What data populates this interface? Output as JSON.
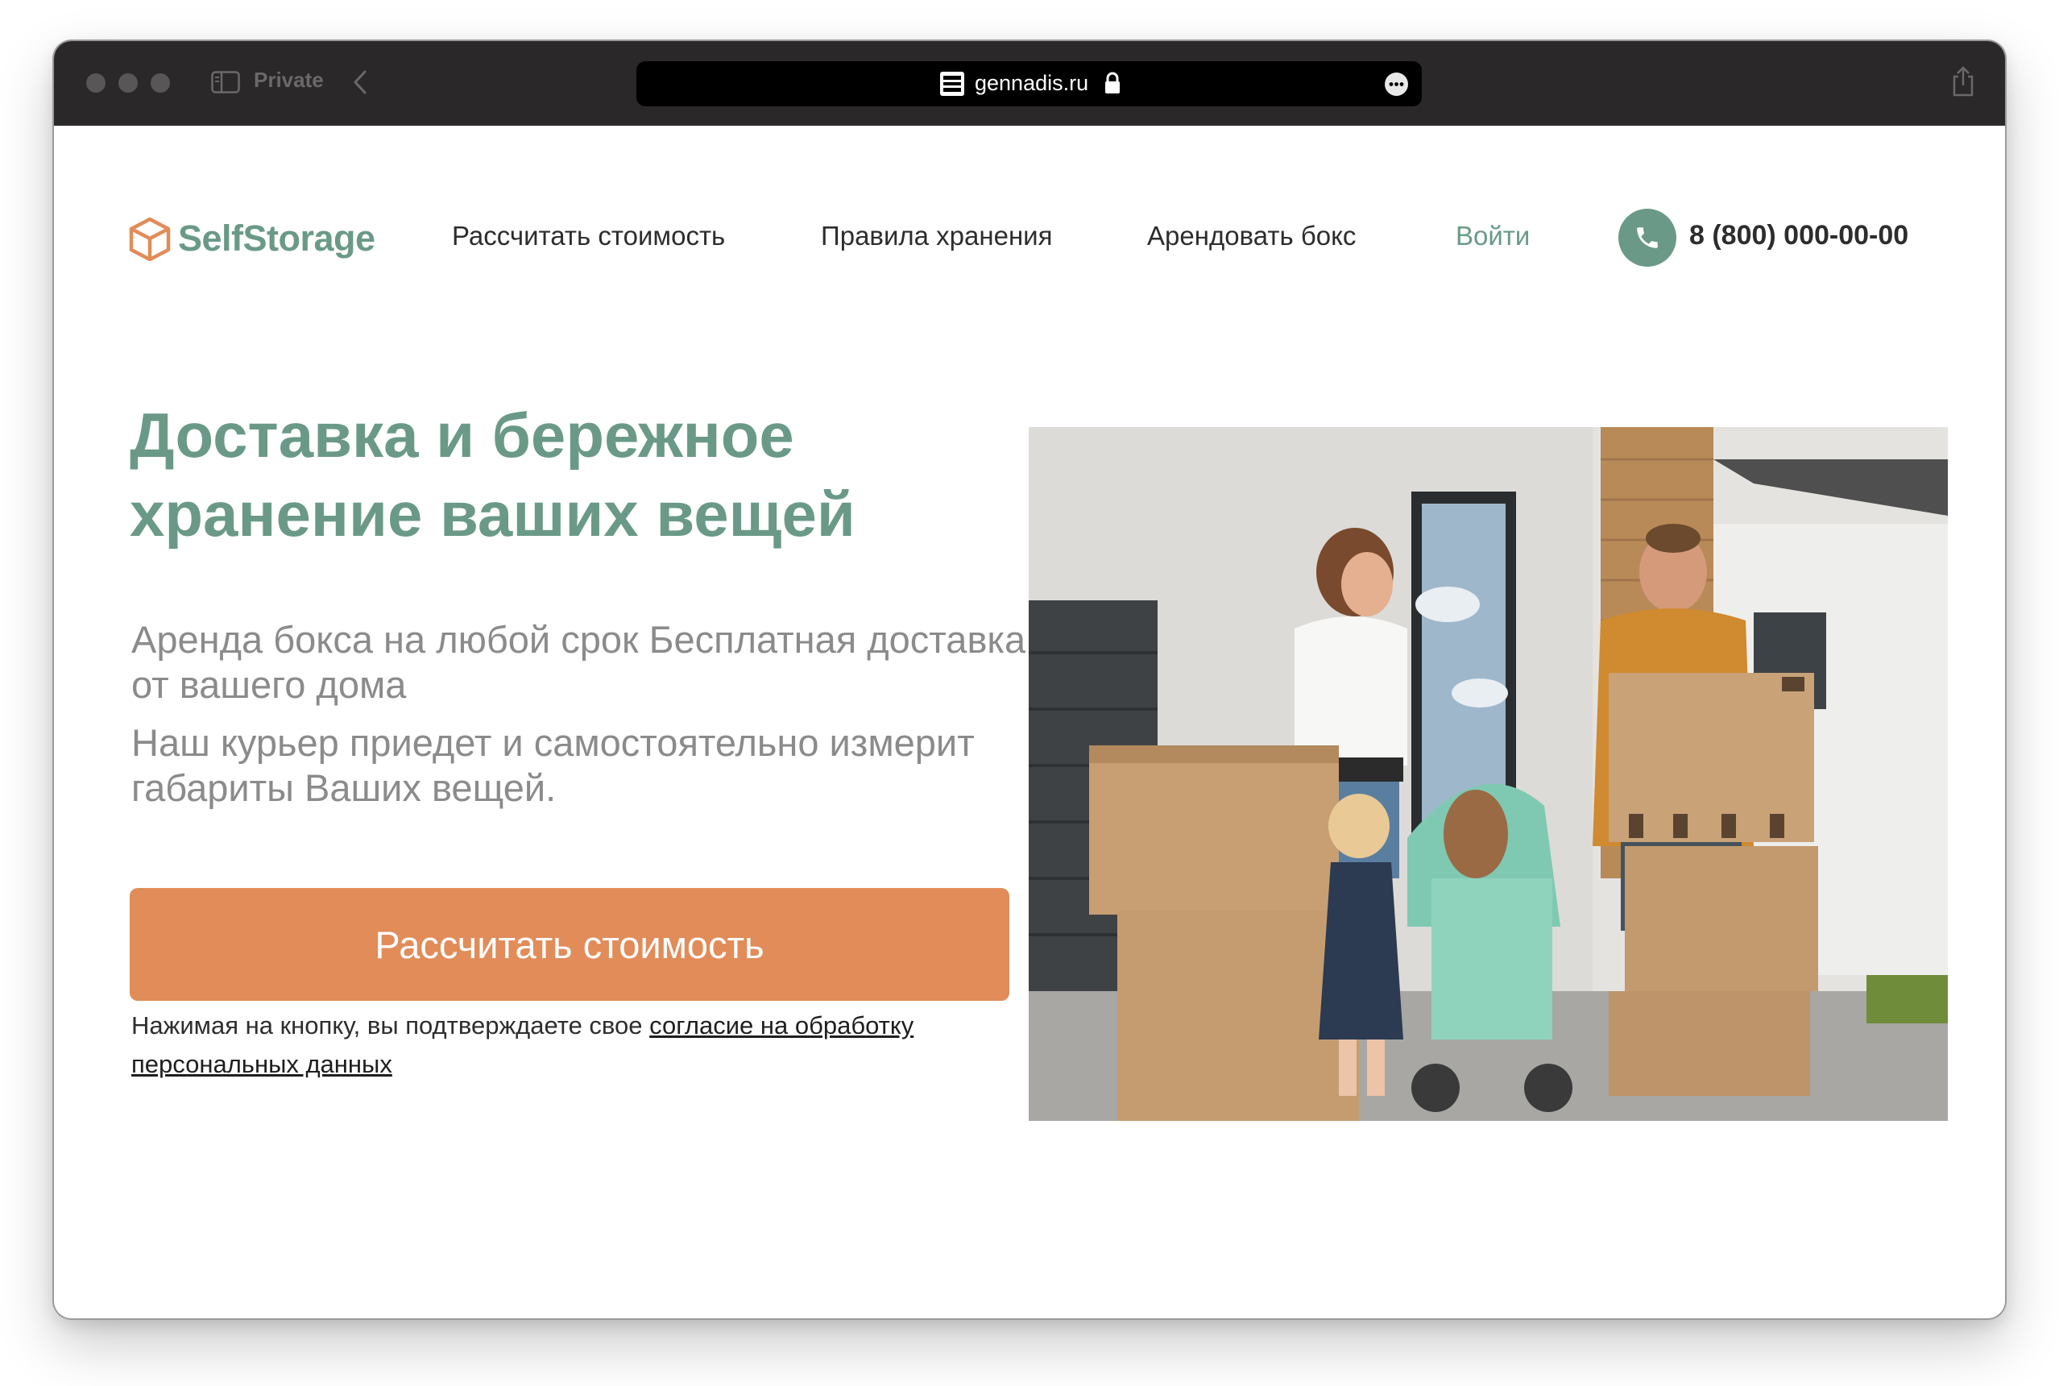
{
  "browser": {
    "mode_label": "Private",
    "url": "gennadis.ru"
  },
  "header": {
    "logo_text": "SelfStorage",
    "nav": {
      "calc": "Рассчитать стоимость",
      "rules": "Правила хранения",
      "rent": "Арендовать бокс",
      "login": "Войти"
    },
    "phone": "8 (800) 000-00-00"
  },
  "hero": {
    "title_line1": "Доставка и бережное",
    "title_line2": "хранение ваших вещей",
    "subtitle1": "Аренда бокса на любой срок Бесплатная доставка от вашего дома",
    "subtitle2": "Наш курьер приедет и самостоятельно измерит габариты Ваших вещей.",
    "cta_label": "Рассчитать стоимость",
    "consent_text": "Нажимая на кнопку, вы подтверждаете свое ",
    "consent_link": "согласие на обработку персональных данных"
  },
  "colors": {
    "brand_green": "#6a9a87",
    "brand_orange": "#e18c59",
    "toolbar": "#2b2829"
  },
  "icons": {
    "logo": "box-icon",
    "phone": "phone-icon",
    "lock": "lock-icon",
    "more": "more-icon",
    "share": "share-icon",
    "back": "chevron-left-icon",
    "sidebar": "sidebar-icon"
  }
}
